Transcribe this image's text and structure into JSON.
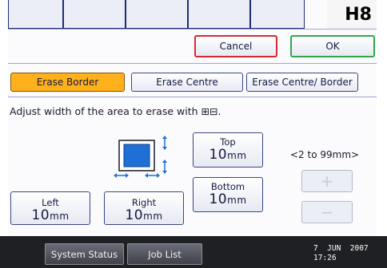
{
  "screen_id": "H8",
  "actions": {
    "cancel_label": "Cancel",
    "ok_label": "OK"
  },
  "erase_modes": [
    {
      "label": "Erase Border",
      "selected": true
    },
    {
      "label": "Erase Centre",
      "selected": false
    },
    {
      "label": "Erase Centre/ Border",
      "selected": false
    }
  ],
  "instruction": "Adjust width of the area to erase with ⊞⊟.",
  "fields": {
    "top": {
      "label": "Top",
      "value": "10",
      "unit": "mm"
    },
    "bottom": {
      "label": "Bottom",
      "value": "10",
      "unit": "mm"
    },
    "left": {
      "label": "Left",
      "value": "10",
      "unit": "mm"
    },
    "right": {
      "label": "Right",
      "value": "10",
      "unit": "mm"
    }
  },
  "range_hint": "<2 to 99mm>",
  "stepper": {
    "plus": "+",
    "minus": "−"
  },
  "status_bar": {
    "system_status_label": "System Status",
    "job_list_label": "Job List",
    "date": "7  JUN  2007",
    "time": "17:26"
  },
  "colors": {
    "selected_tab": "#ffb01d",
    "cancel_border": "#d62a33",
    "ok_border": "#2fa84a",
    "preview_blue": "#1e6fd6"
  }
}
